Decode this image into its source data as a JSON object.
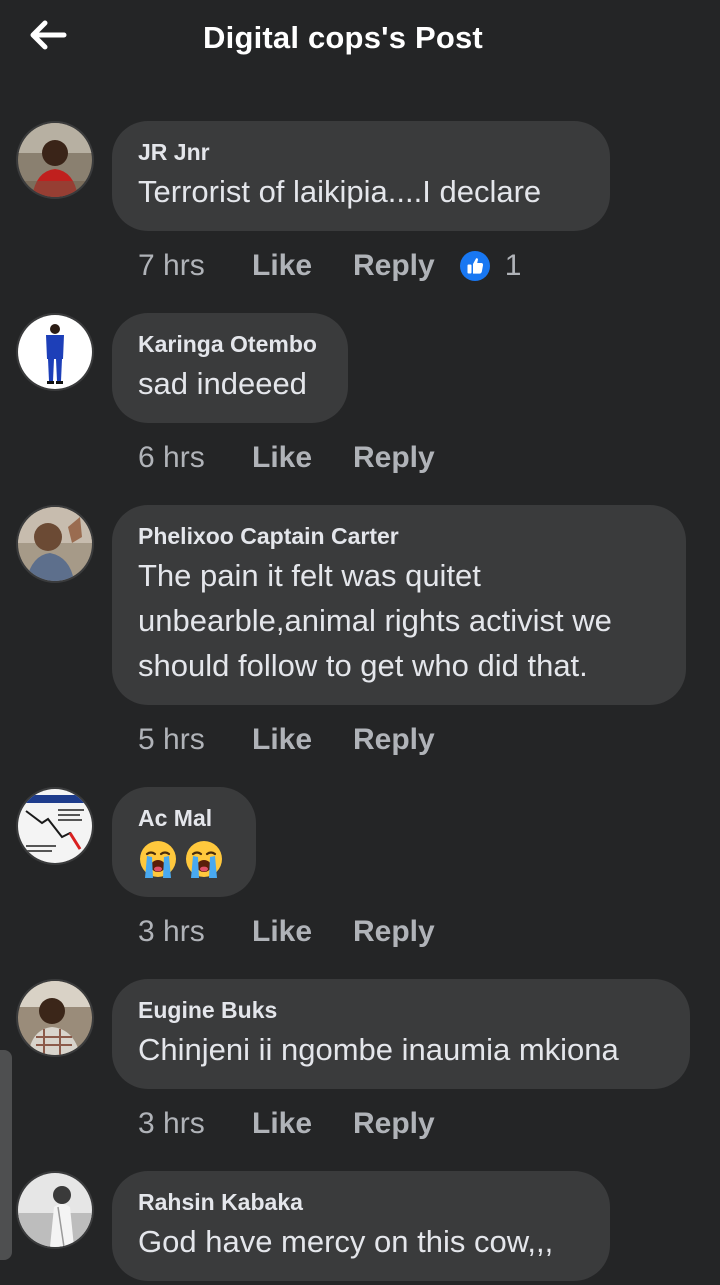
{
  "header": {
    "title": "Digital cops's Post",
    "back_icon": "arrow-left-icon"
  },
  "comments": [
    {
      "author": "JR Jnr",
      "text": "Terrorist of laikipia....I declare",
      "time": "7 hrs",
      "like_label": "Like",
      "reply_label": "Reply",
      "reaction_icon": "thumbs-up-icon",
      "reaction_count": "1"
    },
    {
      "author": "Karinga Otembo",
      "text": "sad indeeed",
      "time": "6 hrs",
      "like_label": "Like",
      "reply_label": "Reply"
    },
    {
      "author": "Phelixoo Captain Carter",
      "text_lines": [
        "The pain it felt was quitet",
        "unbearble,animal rights activist we",
        "should follow to get who did that."
      ],
      "time": "5 hrs",
      "like_label": "Like",
      "reply_label": "Reply"
    },
    {
      "author": "Ac Mal",
      "emoji": [
        "loudly-crying-face-emoji",
        "loudly-crying-face-emoji"
      ],
      "time": "3 hrs",
      "like_label": "Like",
      "reply_label": "Reply"
    },
    {
      "author": "Eugine Buks",
      "text": "Chinjeni ii ngombe inaumia mkiona",
      "time": "3 hrs",
      "like_label": "Like",
      "reply_label": "Reply"
    },
    {
      "author": "Rahsin Kabaka",
      "text": "God have mercy on this cow,,,"
    }
  ],
  "colors": {
    "background": "#242526",
    "bubble": "#3a3b3c",
    "primary_text": "#e4e6eb",
    "secondary_text": "#b0b3b8",
    "like_reaction": "#1877f2"
  }
}
